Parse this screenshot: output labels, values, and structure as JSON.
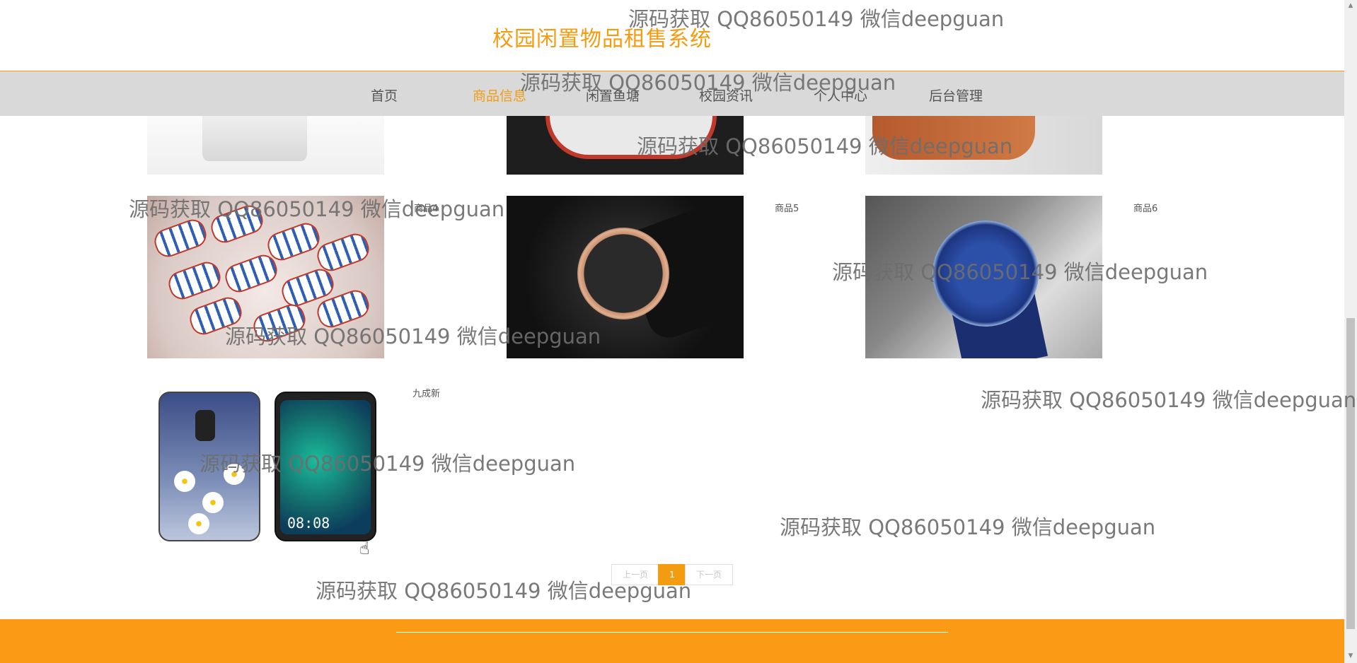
{
  "site": {
    "title": "校园闲置物品租售系统"
  },
  "nav": {
    "items": [
      {
        "label": "首页",
        "active": false
      },
      {
        "label": "商品信息",
        "active": true
      },
      {
        "label": "闲置鱼塘",
        "active": false
      },
      {
        "label": "校园资讯",
        "active": false
      },
      {
        "label": "个人中心",
        "active": false
      },
      {
        "label": "后台管理",
        "active": false
      }
    ]
  },
  "products": [
    {
      "label": "",
      "image": "bag-icon"
    },
    {
      "label": "",
      "image": "shoe-icon"
    },
    {
      "label": "",
      "image": "purse-icon"
    },
    {
      "label": "商品4",
      "image": "candy-icon"
    },
    {
      "label": "商品5",
      "image": "watch-icon"
    },
    {
      "label": "商品6",
      "image": "watch-icon"
    },
    {
      "label": "九成新",
      "image": "phone-icon"
    }
  ],
  "phone_screen_time": "08:08",
  "pagination": {
    "prev": "上一页",
    "current": "1",
    "next": "下一页"
  },
  "watermark": "源码获取 QQ86050149 微信deepguan",
  "colors": {
    "accent": "#f39c12",
    "nav_bg": "#d9d9d9",
    "footer": "#fb9a14"
  }
}
